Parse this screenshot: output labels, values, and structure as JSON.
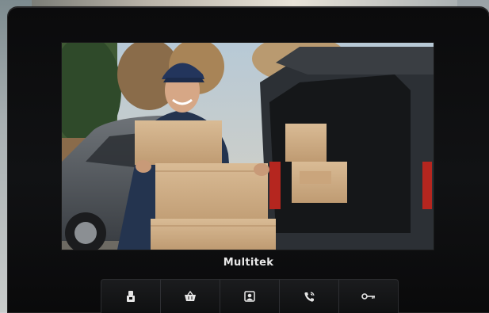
{
  "device": {
    "brand": "Multitek"
  },
  "screen": {
    "scene": "delivery-person-with-boxes"
  },
  "controls": [
    {
      "icon": "door-opener-icon"
    },
    {
      "icon": "basket-icon"
    },
    {
      "icon": "camera-image-icon"
    },
    {
      "icon": "phone-call-icon"
    },
    {
      "icon": "key-icon"
    }
  ],
  "colors": {
    "frame": "#0f1012",
    "icon": "#e6e6e6"
  }
}
